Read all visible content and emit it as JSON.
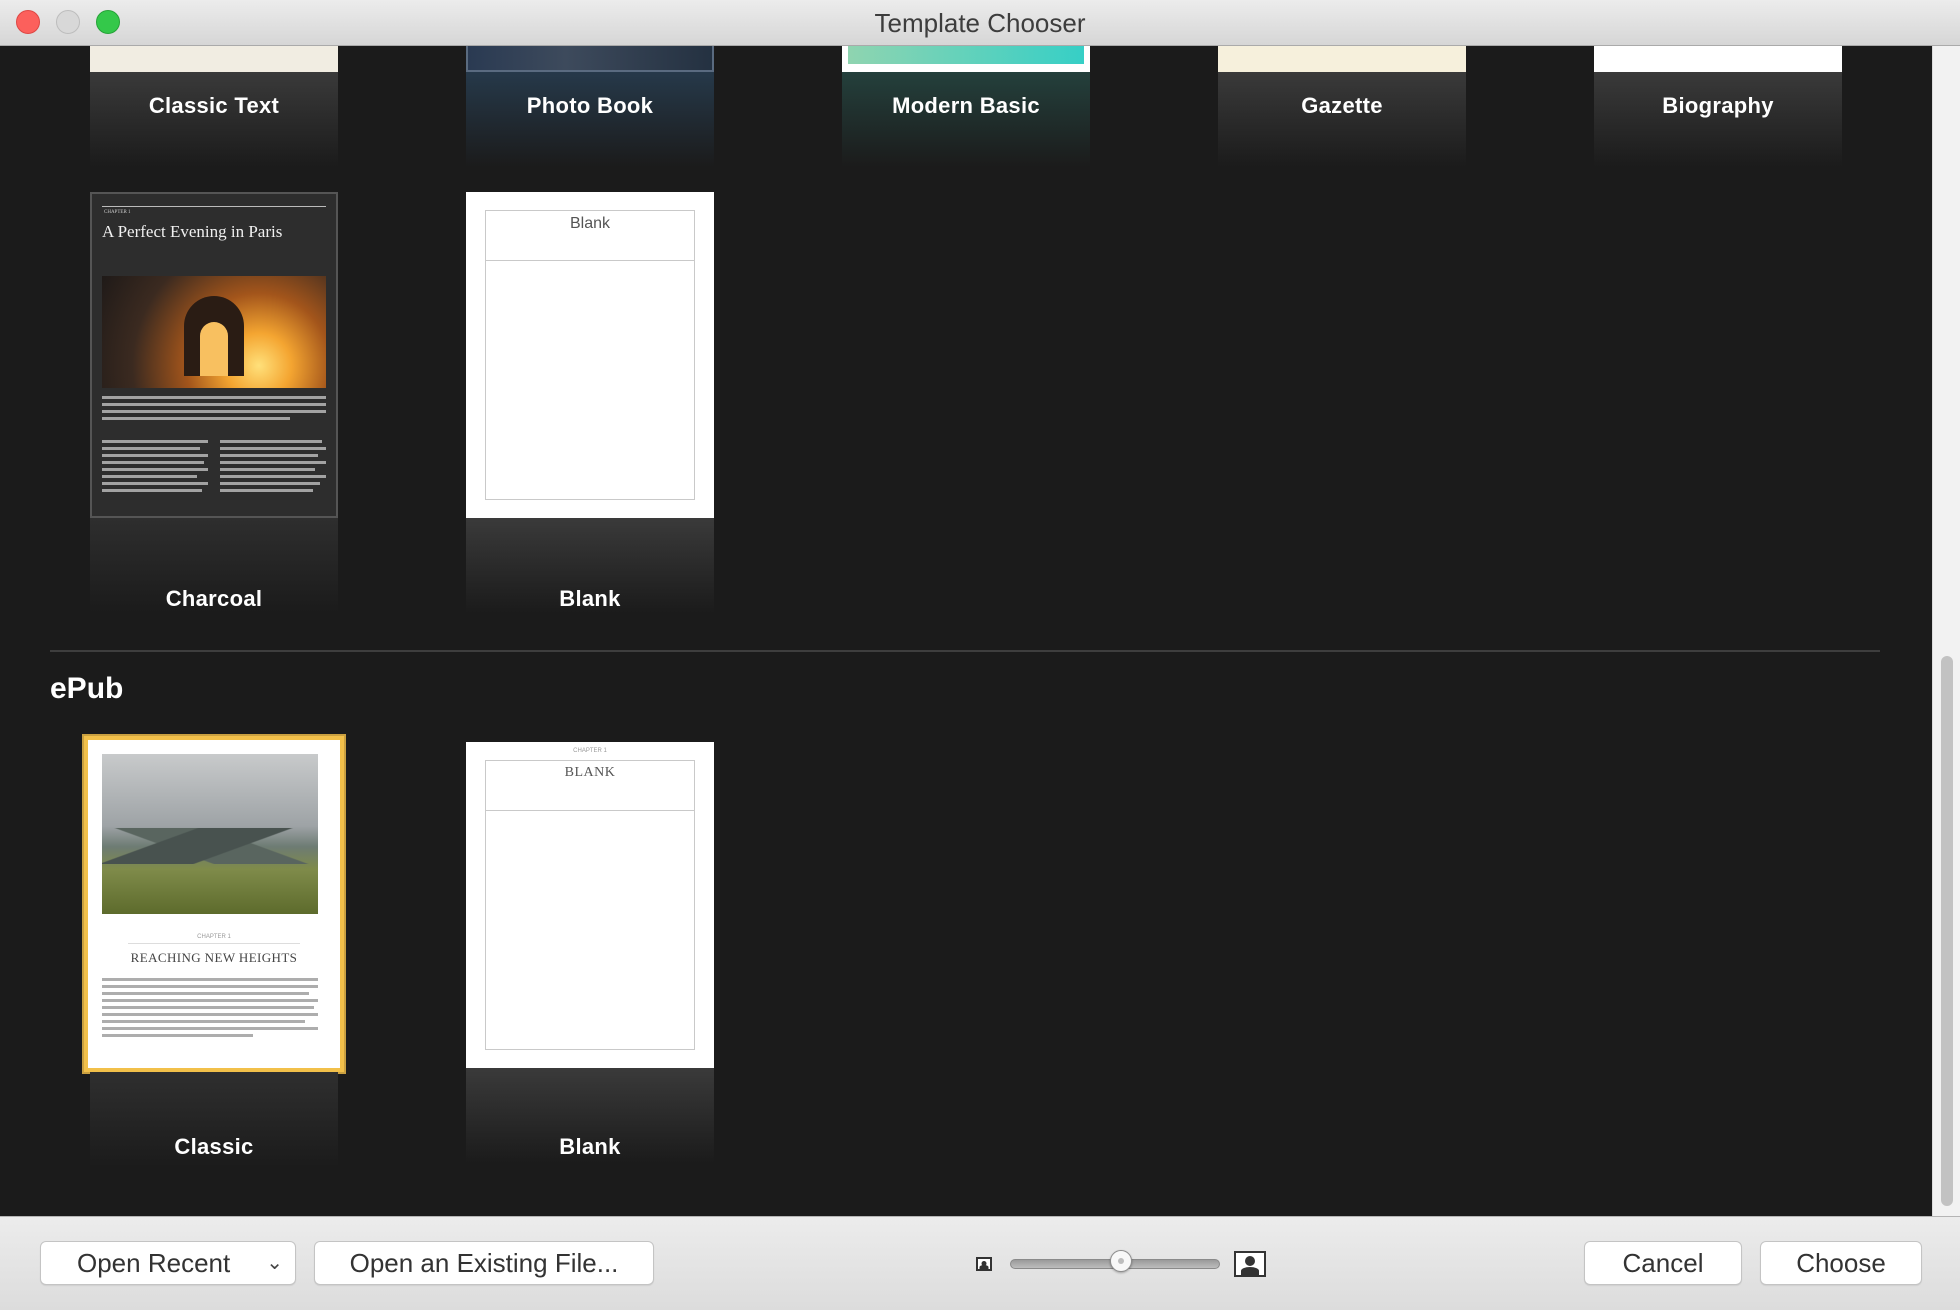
{
  "window": {
    "title": "Template Chooser"
  },
  "templates_top_row": [
    {
      "name": "Classic Text"
    },
    {
      "name": "Photo Book"
    },
    {
      "name": "Modern Basic"
    },
    {
      "name": "Gazette"
    },
    {
      "name": "Biography"
    }
  ],
  "templates_second_row": [
    {
      "name": "Charcoal",
      "preview": {
        "chapter": "CHAPTER 1",
        "title": "A Perfect Evening in Paris"
      }
    },
    {
      "name": "Blank",
      "preview": {
        "title": "Blank"
      }
    }
  ],
  "sections": [
    {
      "title": "ePub"
    }
  ],
  "epub_templates": [
    {
      "name": "Classic",
      "selected": true,
      "preview": {
        "chapter": "CHAPTER 1",
        "title": "REACHING NEW HEIGHTS"
      }
    },
    {
      "name": "Blank",
      "selected": false,
      "preview": {
        "chapter": "CHAPTER 1",
        "title": "BLANK"
      }
    }
  ],
  "footer": {
    "open_recent": "Open Recent",
    "open_existing": "Open an Existing File...",
    "cancel": "Cancel",
    "choose": "Choose",
    "zoom_level": 0.52
  },
  "colors": {
    "background": "#1b1b1b",
    "selection": "#f2c04a",
    "close": "#fc605c",
    "maximize": "#34c84a"
  },
  "icons": [
    "close-icon",
    "minimize-icon",
    "maximize-icon",
    "chevron-down-icon",
    "small-thumbnail-icon",
    "large-thumbnail-icon"
  ]
}
